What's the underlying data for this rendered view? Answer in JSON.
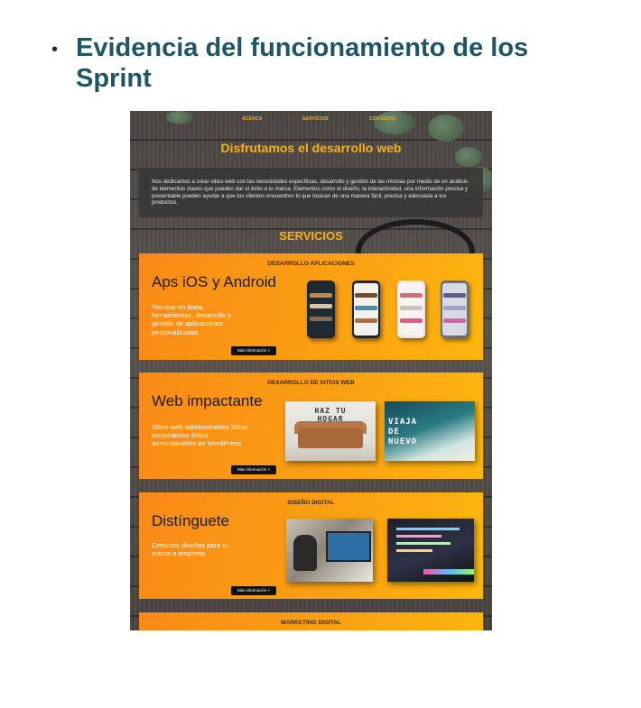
{
  "slide": {
    "bullet": "•",
    "title": "Evidencia del funcionamiento de los Sprint"
  },
  "site": {
    "nav": [
      "ACERCA",
      "SERVICIOS",
      "CONTACTO"
    ],
    "hero_title": "Disfrutamos el desarrollo web",
    "intro": "Nos dedicamos a crear sitios web con las necesidades específicas, desarrollo y gestión de las mismas por medio de un análisis de elementos claves que pueden dar el éxito a tu marca. Elementos como el diseño, la interactividad, una información precisa y presentable pueden ayudar a que tus clientes encuentren lo que buscan de una manera fácil, precisa y adecuada a tus productos.",
    "services_title": "SERVICIOS",
    "cards": [
      {
        "header": "DESARROLLO APLICACIONES",
        "heading": "Aps iOS y Android",
        "text": "Tiendas en línea, herramientas, desarrollo y gestión de aplicaciones personalizadas",
        "button": "Más información >"
      },
      {
        "header": "DESARROLLO DE SITIOS WEB",
        "heading": "Web impactante",
        "text": "Sitios web administrables Sitios corporativos Sitios administrables en WordPress",
        "button": "Más información >",
        "image1_caption": "HAZ TU HOGAR PERFECTO",
        "image2_caption": "VIAJA DE NUEVO"
      },
      {
        "header": "DISEÑO DIGITAL",
        "heading": "Distínguete",
        "text": "Creamos diseños para tu marca o empresa",
        "button": "Más información >"
      },
      {
        "header": "MARKETING DIGITAL"
      }
    ]
  },
  "colors": {
    "title": "#1f5666",
    "accent": "#f6b01b",
    "card_orange": "#f98a17",
    "card_yellow": "#fdb60d",
    "wood": "#4f4a45"
  }
}
